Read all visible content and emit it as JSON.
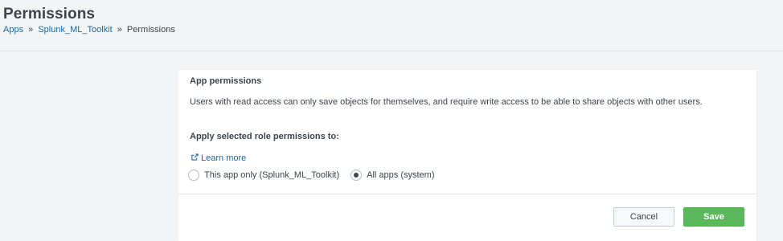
{
  "header": {
    "title": "Permissions",
    "breadcrumb": {
      "apps": "Apps",
      "sep1": "»",
      "toolkit": "Splunk_ML_Toolkit",
      "sep2": "»",
      "current": "Permissions"
    }
  },
  "panel": {
    "section_title": "App permissions",
    "description": "Users with read access can only save objects for themselves, and require write access to be able to share objects with other users.",
    "apply_label": "Apply selected role permissions to:",
    "learn_more": "Learn more",
    "learn_more_icon": "external-link-icon",
    "radio_options": [
      {
        "label": "This app only (Splunk_ML_Toolkit)",
        "checked": false
      },
      {
        "label": "All apps (system)",
        "checked": true
      }
    ]
  },
  "footer": {
    "cancel_label": "Cancel",
    "save_label": "Save"
  },
  "colors": {
    "link": "#1a6aa5",
    "save_button": "#5cb85c",
    "background": "#f2f4f5"
  }
}
